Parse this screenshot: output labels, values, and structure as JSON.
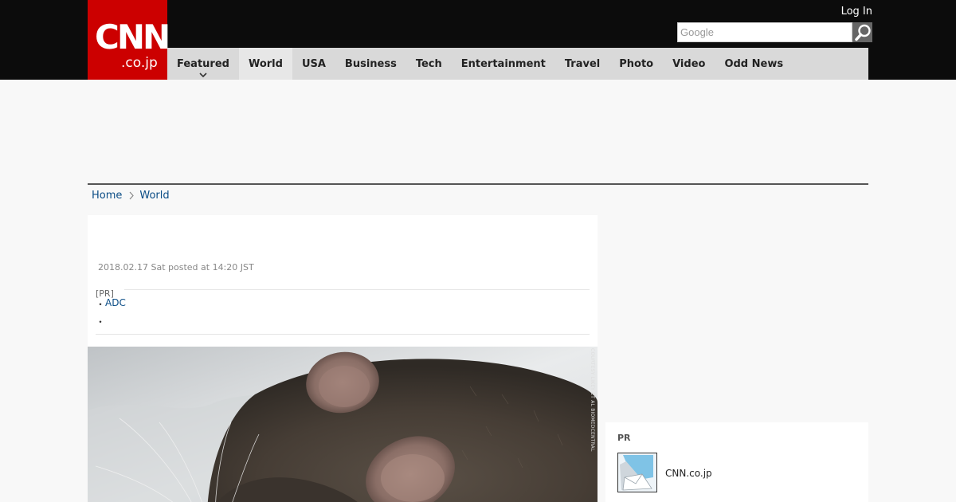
{
  "header": {
    "logo": {
      "main": "CNN",
      "sub": ".co.jp"
    },
    "login_label": "Log In",
    "search": {
      "placeholder": "Google",
      "value": ""
    }
  },
  "nav": {
    "items": [
      {
        "label": "Featured"
      },
      {
        "label": "World"
      },
      {
        "label": "USA"
      },
      {
        "label": "Business"
      },
      {
        "label": "Tech"
      },
      {
        "label": "Entertainment"
      },
      {
        "label": "Travel"
      },
      {
        "label": "Photo"
      },
      {
        "label": "Video"
      },
      {
        "label": "Odd News"
      }
    ],
    "active": "World"
  },
  "breadcrumb": {
    "home": "Home",
    "current": "World"
  },
  "article": {
    "date": "2018.02.17 Sat posted at 14:20 JST",
    "pr": {
      "label": "[PR]",
      "items": [
        {
          "text": "ADC"
        },
        {
          "text": ""
        }
      ]
    },
    "photo": {
      "credit": "COURTESY LIKEY ET AL BIOMEDCENTRAL",
      "subject": "rat"
    }
  },
  "sidebar": {
    "pr_title": "PR",
    "pr_link": "CNN.co.jp"
  },
  "colors": {
    "brand_red": "#cc0000",
    "topbar": "#0c0c0c",
    "nav_bg": "#d9d9d9",
    "link": "#0b4d86"
  },
  "icons": {
    "search": "magnifier-icon",
    "featured_dropdown": "chevron-down-icon",
    "breadcrumb_separator": "chevron-right-icon"
  }
}
